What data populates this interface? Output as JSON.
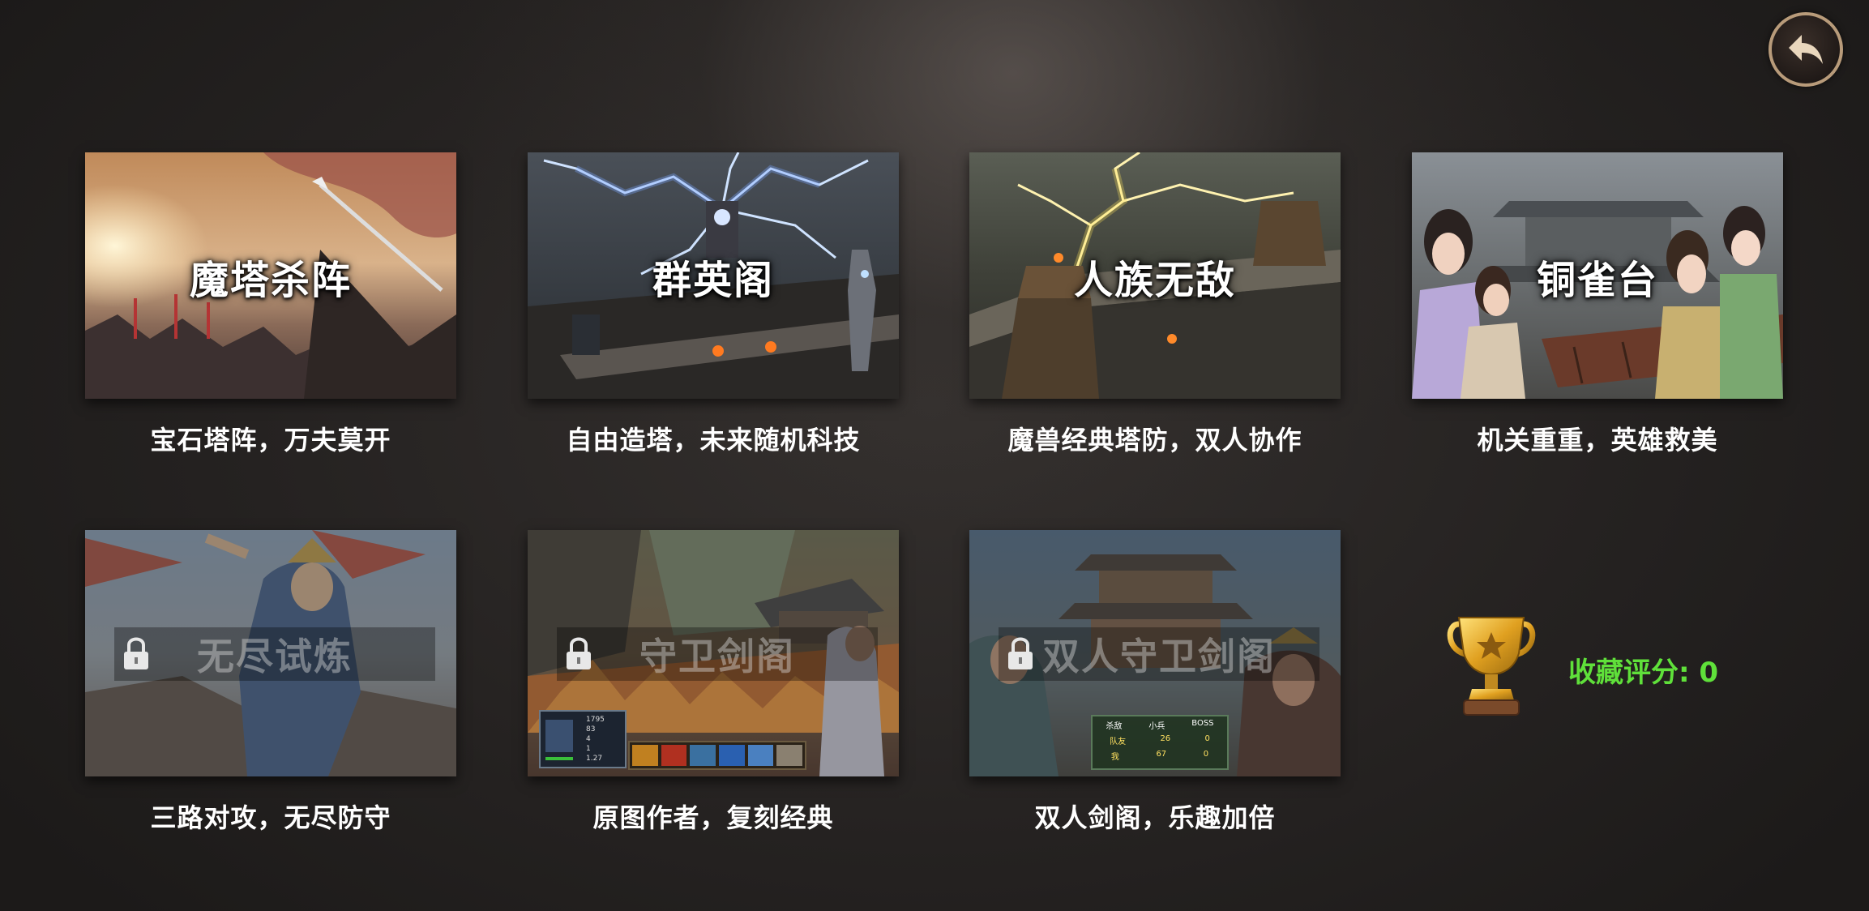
{
  "header": {
    "back_button": "back-arrow-icon"
  },
  "levels": [
    {
      "title": "魔塔杀阵",
      "caption": "宝石塔阵，万夫莫开",
      "locked": false
    },
    {
      "title": "群英阁",
      "caption": "自由造塔，未来随机科技",
      "locked": false
    },
    {
      "title": "人族无敌",
      "caption": "魔兽经典塔防，双人协作",
      "locked": false
    },
    {
      "title": "铜雀台",
      "caption": "机关重重，英雄救美",
      "locked": false
    },
    {
      "title": "无尽试炼",
      "caption": "三路对攻，无尽防守",
      "locked": true
    },
    {
      "title": "守卫剑阁",
      "caption": "原图作者，复刻经典",
      "locked": true
    },
    {
      "title": "双人守卫剑阁",
      "caption": "双人剑阁，乐趣加倍",
      "locked": true
    }
  ],
  "hud6": {
    "stats": [
      "1795",
      "83",
      "4",
      "1",
      "1.27"
    ]
  },
  "hud7": {
    "headers": [
      "杀敌",
      "小兵",
      "BOSS"
    ],
    "rows": [
      {
        "name": "队友",
        "kills": "26",
        "boss": "0"
      },
      {
        "name": "我",
        "kills": "67",
        "boss": "0"
      }
    ]
  },
  "collection": {
    "label": "收藏评分: 0",
    "icon": "trophy-icon"
  },
  "colors": {
    "score": "#5fe03a",
    "back_ring": "#b89b7a"
  }
}
